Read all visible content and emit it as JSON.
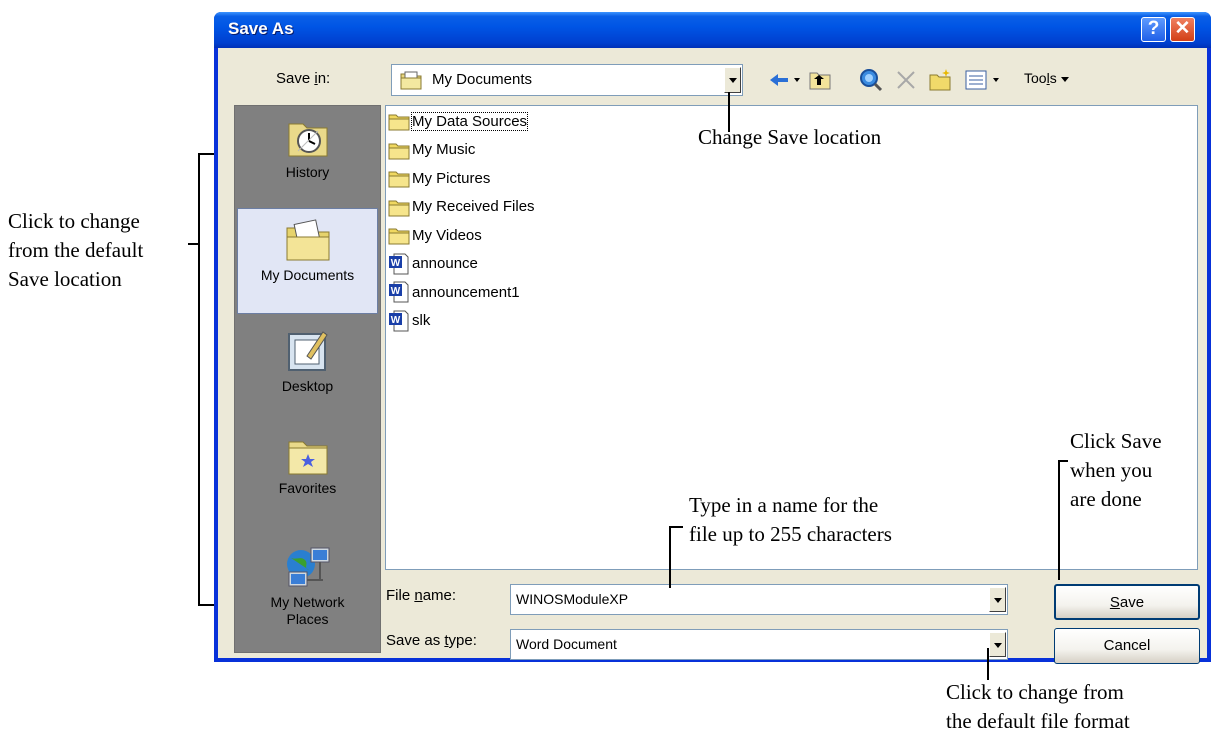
{
  "window": {
    "title": "Save As",
    "help_glyph": "?",
    "close_glyph": "✕"
  },
  "save_in": {
    "label_prefix": "Save ",
    "label_hotkey": "i",
    "label_suffix": "n:",
    "value": "My Documents",
    "toolbar": {
      "tools_prefix": "Too",
      "tools_hotkey": "l",
      "tools_suffix": "s"
    }
  },
  "places": [
    {
      "label": "History",
      "icon": "history-icon"
    },
    {
      "label": "My Documents",
      "icon": "my-documents-icon",
      "selected": true
    },
    {
      "label": "Desktop",
      "icon": "desktop-icon"
    },
    {
      "label": "Favorites",
      "icon": "favorites-icon"
    },
    {
      "label": "My Network\nPlaces",
      "icon": "network-places-icon"
    }
  ],
  "files": [
    {
      "name": "My Data Sources",
      "type": "folder"
    },
    {
      "name": "My Music",
      "type": "folder"
    },
    {
      "name": "My Pictures",
      "type": "folder"
    },
    {
      "name": "My Received Files",
      "type": "folder"
    },
    {
      "name": "My Videos",
      "type": "folder"
    },
    {
      "name": "announce",
      "type": "word-document"
    },
    {
      "name": "announcement1",
      "type": "word-document"
    },
    {
      "name": "slk",
      "type": "word-document"
    }
  ],
  "file_name": {
    "label_prefix": "File ",
    "label_hotkey": "n",
    "label_suffix": "ame:",
    "value": "WINOSModuleXP"
  },
  "save_as_type": {
    "label_prefix": "Save as ",
    "label_hotkey": "t",
    "label_suffix": "ype:",
    "value": "Word Document"
  },
  "buttons": {
    "save_hotkey": "S",
    "save_rest": "ave",
    "cancel": "Cancel"
  },
  "annotations": {
    "left": "Click to change\nfrom the default\nSave location",
    "top": "Change Save location",
    "middle": "Type in a name for the\nfile up to 255 characters",
    "save": "Click Save\nwhen you\nare done",
    "format": "Click to change from\nthe default file format"
  }
}
